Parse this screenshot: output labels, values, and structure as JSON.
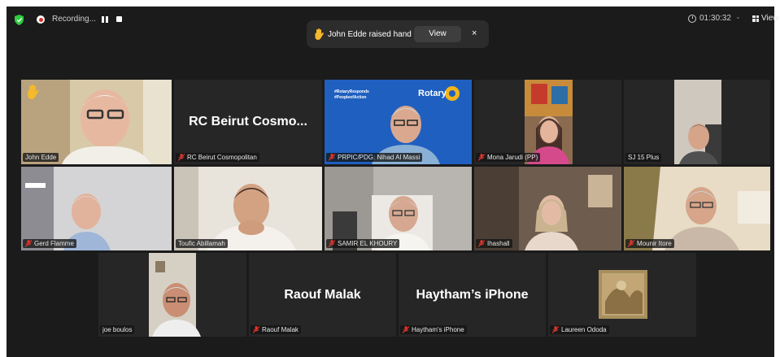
{
  "recording": {
    "label": "Recording..."
  },
  "timer": {
    "text": "01:30:32"
  },
  "view_button": {
    "label": "View"
  },
  "notification": {
    "text": "John Edde raised hand",
    "view_label": "View",
    "close_label": "×"
  },
  "participants": [
    {
      "name": "John Edde",
      "big_name": "",
      "muted": false,
      "raised_hand": true,
      "active_speaker": true
    },
    {
      "name": "RC Beirut Cosmopolitan",
      "big_name": "RC Beirut Cosmo...",
      "muted": true
    },
    {
      "name": "PRPIC/PDG: Nihad Al Massi",
      "big_name": "",
      "muted": true,
      "banner": [
        "#RotaryResponds",
        "#PeopleofAction"
      ],
      "logo_text": "Rotary"
    },
    {
      "name": "Mona Jarudi (PP)",
      "big_name": "",
      "muted": true
    },
    {
      "name": "SJ 15 Plus",
      "big_name": "",
      "muted": false
    },
    {
      "name": "Gerd Flamme",
      "big_name": "",
      "muted": true
    },
    {
      "name": "Toufic Abillamah",
      "big_name": "",
      "muted": false
    },
    {
      "name": "SAMIR EL KHOURY",
      "big_name": "",
      "muted": true
    },
    {
      "name": "Ihashall",
      "big_name": "",
      "muted": true
    },
    {
      "name": "Mounir Itore",
      "big_name": "",
      "muted": true
    },
    {
      "name": "joe boulos",
      "big_name": "",
      "muted": false
    },
    {
      "name": "Raouf Malak",
      "big_name": "Raouf Malak",
      "muted": true
    },
    {
      "name": "Haytham's iPhone",
      "big_name": "Haytham’s iPhone",
      "muted": true
    },
    {
      "name": "Laureen Ododa",
      "big_name": "",
      "muted": true
    }
  ],
  "colors": {
    "window_bg": "#1b1b1b",
    "tile_bg": "#262626",
    "active_border": "#d3e36a",
    "mute_red": "#e0342c",
    "recording_red": "#e02828",
    "rotary_blue": "#1f5fbf"
  }
}
